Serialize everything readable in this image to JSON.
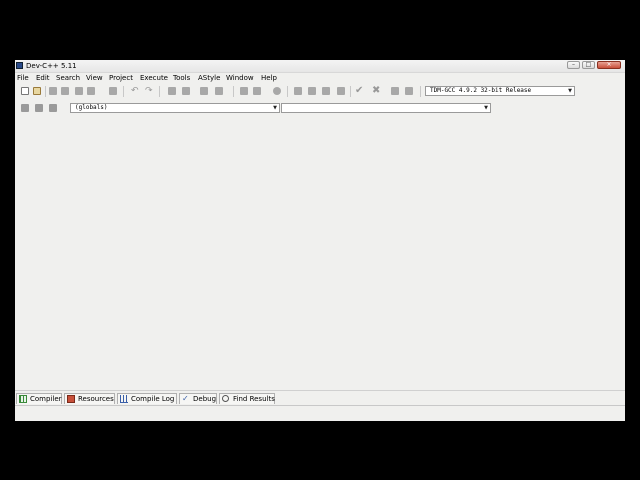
{
  "window": {
    "title": "Dev-C++ 5.11",
    "controls": {
      "minimize": "–",
      "maximize": "□",
      "close": "×"
    }
  },
  "menu": [
    "File",
    "Edit",
    "Search",
    "View",
    "Project",
    "Execute",
    "Tools",
    "AStyle",
    "Window",
    "Help"
  ],
  "toolbar": {
    "compiler_select": {
      "value": "TDM-GCC 4.9.2 32-bit Release"
    },
    "scope_select": {
      "value": "(globals)"
    },
    "member_select": {
      "value": ""
    }
  },
  "bottom_tabs": [
    {
      "label": "Compiler",
      "icon": "compiler-grid-icon"
    },
    {
      "label": "Resources",
      "icon": "resources-icon"
    },
    {
      "label": "Compile Log",
      "icon": "chart-icon"
    },
    {
      "label": "Debug",
      "icon": "debug-check-icon"
    },
    {
      "label": "Find Results",
      "icon": "find-icon"
    }
  ],
  "colors": {
    "background": "#000000",
    "window": "#f0f0ee",
    "icon_gray": "#9a9a9a",
    "icon_green": "#3a8a3a",
    "icon_blue": "#3a5fa8"
  }
}
